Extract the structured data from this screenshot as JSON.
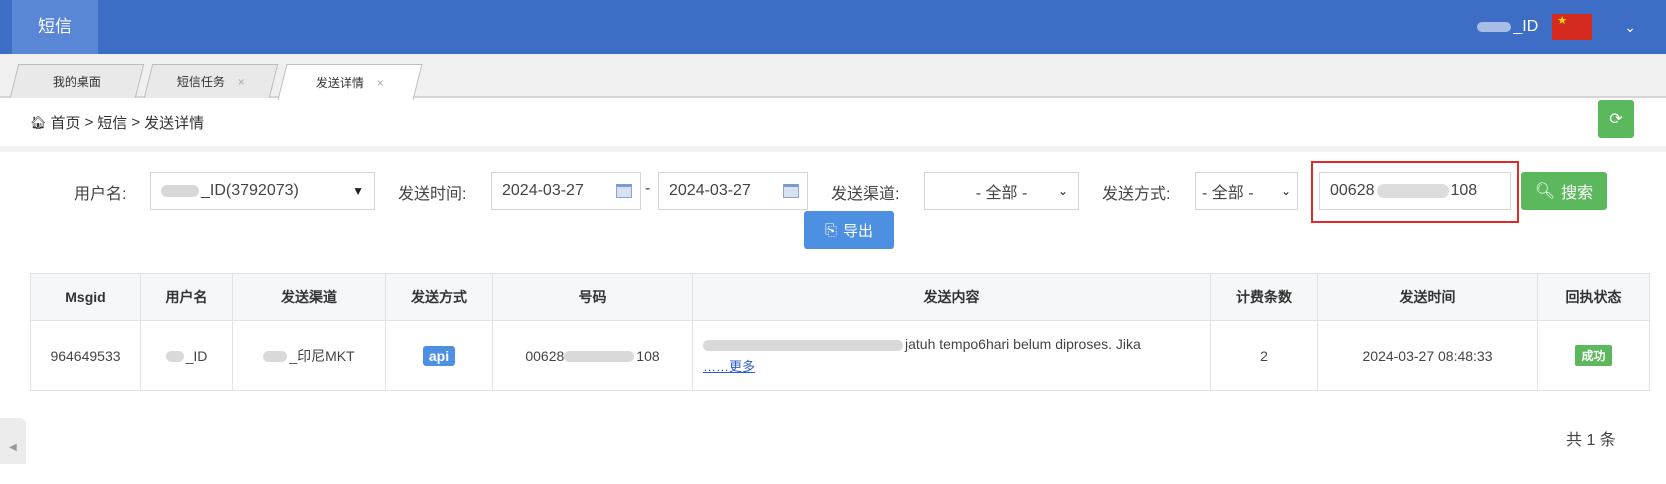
{
  "header": {
    "brand": "短信",
    "user_suffix": "_ID",
    "flag_icon": "china-flag-icon",
    "menu_icon": "chevron-down-icon"
  },
  "tabs": [
    {
      "label": "我的桌面",
      "closable": false
    },
    {
      "label": "短信任务",
      "closable": true,
      "close": "×"
    },
    {
      "label": "发送详情",
      "closable": true,
      "close": "×",
      "active": true
    }
  ],
  "breadcrumb": {
    "home": "首页",
    "sep": ">",
    "level2": "短信",
    "level3": "发送详情"
  },
  "filters": {
    "username_label": "用户名:",
    "username_value": "_ID(3792073)",
    "send_time_label": "发送时间:",
    "date_from": "2024-03-27",
    "date_sep": "-",
    "date_to": "2024-03-27",
    "channel_label": "发送渠道:",
    "channel_value": "- 全部 -",
    "method_label": "发送方式:",
    "method_value": "- 全部 -",
    "phone_prefix": "00628",
    "phone_suffix": "108",
    "search_label": "搜索",
    "export_label": "导出"
  },
  "table": {
    "columns": [
      "Msgid",
      "用户名",
      "发送渠道",
      "发送方式",
      "号码",
      "发送内容",
      "计费条数",
      "发送时间",
      "回执状态"
    ],
    "rows": [
      {
        "msgid": "964649533",
        "username": "_ID",
        "channel": "_印尼MKT",
        "method": "api",
        "number_prefix": "00628",
        "number_suffix": "108",
        "content_visible": "jatuh tempo6hari belum diproses. Jika",
        "more": "……更多",
        "billing_count": "2",
        "send_time": "2024-03-27 08:48:33",
        "status": "成功"
      }
    ]
  },
  "pagination": {
    "total": "共 1 条"
  },
  "colors": {
    "header": "#3e6dc5",
    "accent_green": "#5cb85c",
    "accent_blue": "#4d8fe0",
    "highlight_red": "#e02a2a"
  }
}
